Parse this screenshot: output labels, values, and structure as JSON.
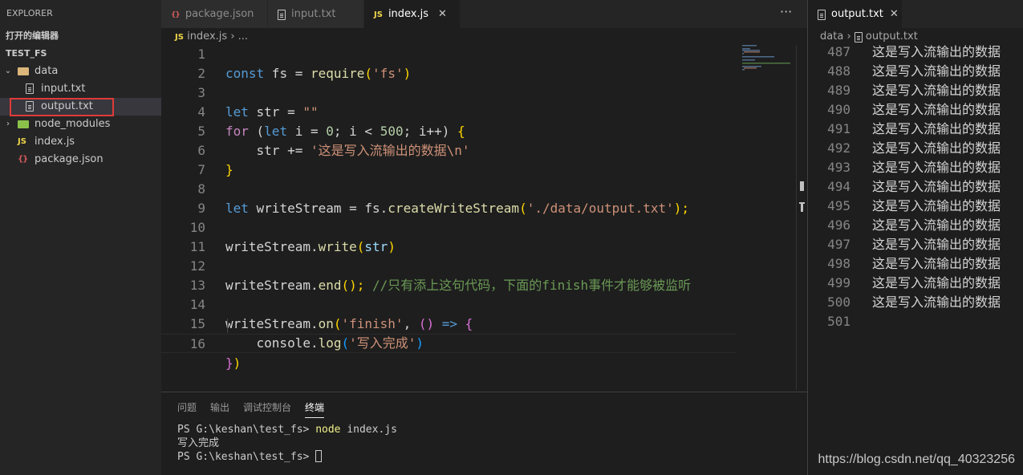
{
  "sidebar": {
    "title": "EXPLORER",
    "open_editors": "打开的编辑器",
    "project": "TEST_FS",
    "tree": {
      "data_folder": "data",
      "input_file": "input.txt",
      "output_file": "output.txt",
      "node_modules": "node_modules",
      "index_js": "index.js",
      "package_json": "package.json"
    },
    "icons": {
      "js": "JS",
      "json": "{}"
    }
  },
  "editor": {
    "tabs": [
      {
        "label": "package.json",
        "icon": "json-icon"
      },
      {
        "label": "input.txt",
        "icon": "file-icon"
      },
      {
        "label": "index.js",
        "icon": "js-icon",
        "active": true
      }
    ],
    "more": "···",
    "breadcrumb": {
      "file": "index.js",
      "rest": "..."
    },
    "line_numbers": [
      "1",
      "2",
      "3",
      "4",
      "5",
      "6",
      "7",
      "8",
      "9",
      "10",
      "11",
      "12",
      "13",
      "14",
      "15",
      "16"
    ],
    "code": {
      "l1_kw": "const",
      "l1_a": " fs = ",
      "l1_fn": "require",
      "l1_p1": "(",
      "l1_str": "'fs'",
      "l1_p2": ")",
      "l3_kw": "let",
      "l3_a": " str = ",
      "l3_str": "\"\"",
      "l4_kw": "for",
      "l4_a": " (",
      "l4_kw2": "let",
      "l4_b": " i = ",
      "l4_n1": "0",
      "l4_c": "; i < ",
      "l4_n2": "500",
      "l4_d": "; i++) ",
      "l4_br": "{",
      "l5_a": "    str += ",
      "l5_str": "'这是写入流输出的数据\\n'",
      "l6_br": "}",
      "l8_kw": "let",
      "l8_a": " writeStream = fs.",
      "l8_fn": "createWriteStream",
      "l8_p1": "(",
      "l8_str": "'./data/output.txt'",
      "l8_p2": ");",
      "l10_a": "writeStream.",
      "l10_fn": "write",
      "l10_p1": "(",
      "l10_var": "str",
      "l10_p2": ")",
      "l12_a": "writeStream.",
      "l12_fn": "end",
      "l12_p": "();",
      "l12_cmt": " //只有添上这句代码，下面的finish事件才能够被监听",
      "l14_a": "writeStream.",
      "l14_fn": "on",
      "l14_p1": "(",
      "l14_str": "'finish'",
      "l14_b": ", ",
      "l14_p2": "()",
      "l14_arrow": " => ",
      "l14_br": "{",
      "l15_a": "    console.",
      "l15_fn": "log",
      "l15_p1": "(",
      "l15_str": "'写入完成'",
      "l15_p2": ")",
      "l16_br": "}",
      "l16_p": ")"
    }
  },
  "panel": {
    "tabs": [
      "问题",
      "输出",
      "调试控制台",
      "终端"
    ],
    "active_tab": "终端",
    "terminal": {
      "prompt1": "PS G:\\keshan\\test_fs> ",
      "cmd1": "node",
      "arg1": " index.js",
      "output": "写入完成",
      "prompt2": "PS G:\\keshan\\test_fs> "
    }
  },
  "output_editor": {
    "tab_label": "output.txt",
    "breadcrumb_folder": "data",
    "breadcrumb_file": "output.txt",
    "lines": [
      {
        "n": "487",
        "t": "这是写入流输出的数据"
      },
      {
        "n": "488",
        "t": "这是写入流输出的数据"
      },
      {
        "n": "489",
        "t": "这是写入流输出的数据"
      },
      {
        "n": "490",
        "t": "这是写入流输出的数据"
      },
      {
        "n": "491",
        "t": "这是写入流输出的数据"
      },
      {
        "n": "492",
        "t": "这是写入流输出的数据"
      },
      {
        "n": "493",
        "t": "这是写入流输出的数据"
      },
      {
        "n": "494",
        "t": "这是写入流输出的数据"
      },
      {
        "n": "495",
        "t": "这是写入流输出的数据"
      },
      {
        "n": "496",
        "t": "这是写入流输出的数据"
      },
      {
        "n": "497",
        "t": "这是写入流输出的数据"
      },
      {
        "n": "498",
        "t": "这是写入流输出的数据"
      },
      {
        "n": "499",
        "t": "这是写入流输出的数据"
      },
      {
        "n": "500",
        "t": "这是写入流输出的数据"
      },
      {
        "n": "501",
        "t": ""
      }
    ]
  },
  "watermark": "https://blog.csdn.net/qq_40323256",
  "colors": {
    "highlight_box": "#e03a3a",
    "keyword": "#569cd6",
    "string": "#ce9178",
    "function": "#dcdcaa",
    "comment": "#6a9955"
  }
}
